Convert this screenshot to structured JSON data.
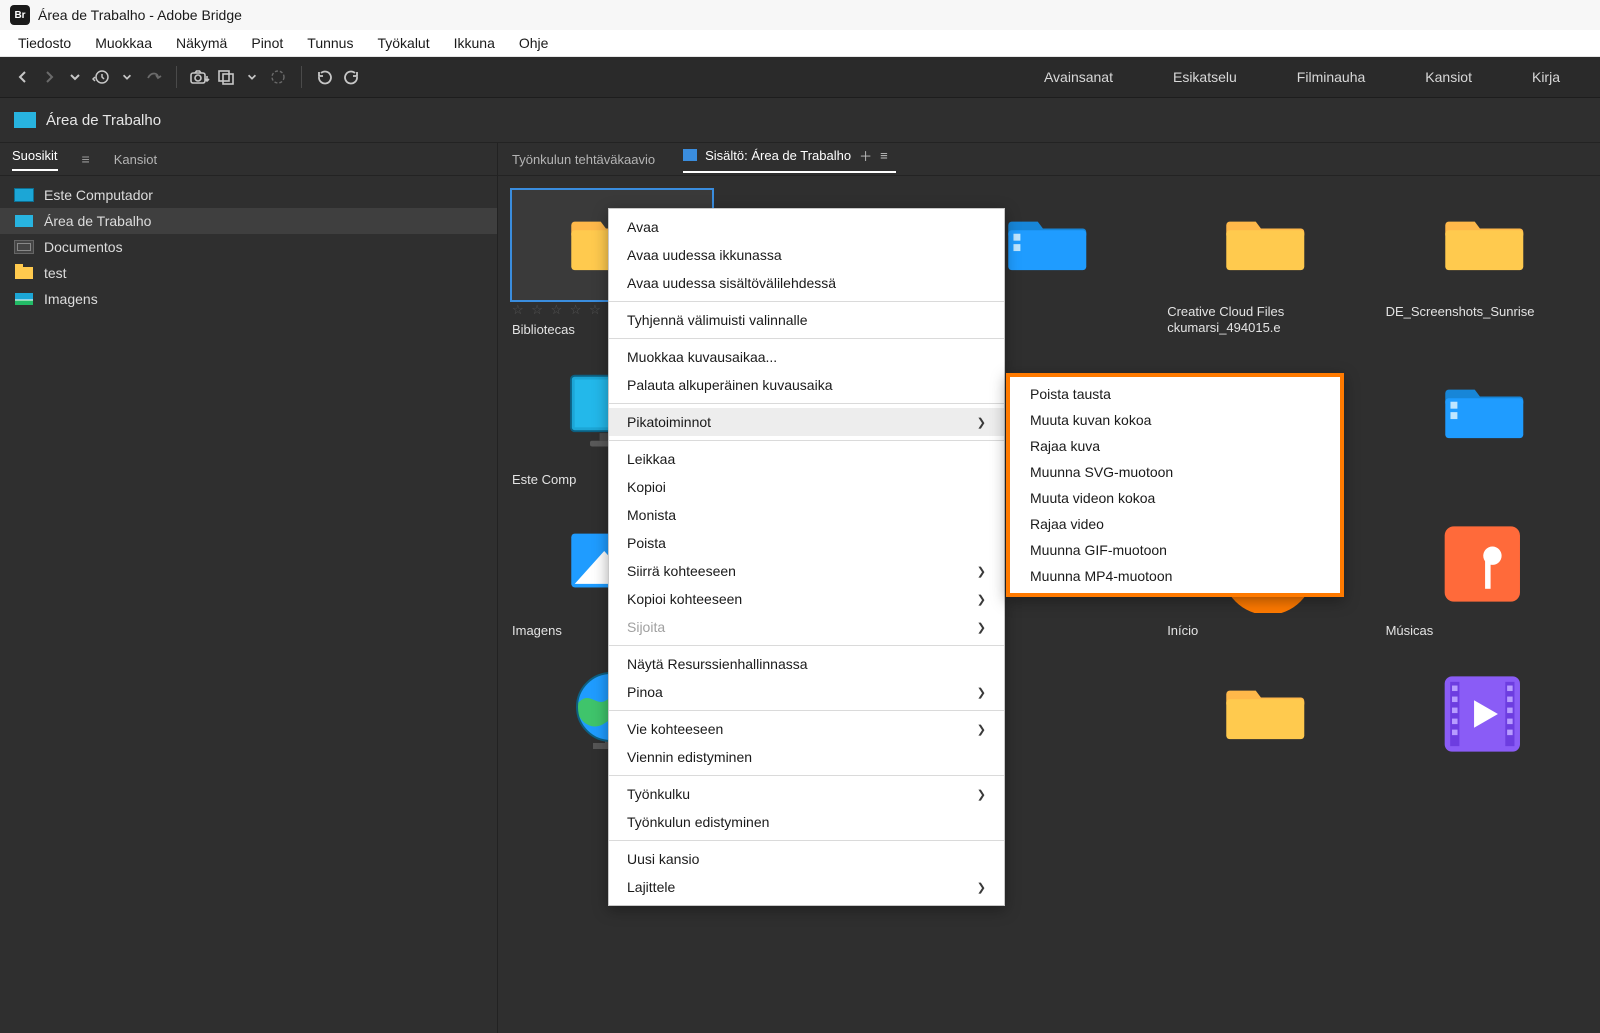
{
  "app_badge": "Br",
  "window_title": "Área de Trabalho - Adobe Bridge",
  "menubar": [
    "Tiedosto",
    "Muokkaa",
    "Näkymä",
    "Pinot",
    "Tunnus",
    "Työkalut",
    "Ikkuna",
    "Ohje"
  ],
  "workspaces": [
    "Avainsanat",
    "Esikatselu",
    "Filminauha",
    "Kansiot",
    "Kirja"
  ],
  "path": "Área de Trabalho",
  "left": {
    "tabs": {
      "suosikit": "Suosikit",
      "kansiot": "Kansiot"
    },
    "items": [
      {
        "label": "Este Computador",
        "icon": "monitor"
      },
      {
        "label": "Área de Trabalho",
        "icon": "blue",
        "selected": true
      },
      {
        "label": "Documentos",
        "icon": "docs"
      },
      {
        "label": "test",
        "icon": "folder"
      },
      {
        "label": "Imagens",
        "icon": "pic"
      }
    ]
  },
  "right": {
    "tab_workflow": "Työnkulun tehtäväkaavio",
    "tab_content": "Sisältö: Área de Trabalho"
  },
  "grid": [
    {
      "label": "Bibliotecas",
      "type": "folder",
      "selected": true,
      "stars": true
    },
    {
      "label": "",
      "type": "folder"
    },
    {
      "label": "",
      "type": "folder-blue"
    },
    {
      "label": "Creative Cloud Files ckumarsi_494015.e",
      "type": "folder"
    },
    {
      "label": "DE_Screenshots_Sunrise",
      "type": "folder"
    },
    {
      "label": "Este Comp",
      "type": "monitor"
    },
    {
      "label": "",
      "type": "hidden"
    },
    {
      "label": "",
      "type": "hidden"
    },
    {
      "label": "",
      "type": "folder-blue"
    },
    {
      "label": "",
      "type": "folder-blue"
    },
    {
      "label": "Imagens",
      "type": "image"
    },
    {
      "label": "",
      "type": "hidden"
    },
    {
      "label": "",
      "type": "hidden"
    },
    {
      "label": "Início",
      "type": "house"
    },
    {
      "label": "Músicas",
      "type": "note"
    },
    {
      "label": "",
      "type": "globe"
    },
    {
      "label": "",
      "type": "hidden"
    },
    {
      "label": "",
      "type": "hidden"
    },
    {
      "label": "",
      "type": "folder"
    },
    {
      "label": "",
      "type": "clip"
    }
  ],
  "context_menu": {
    "items": [
      {
        "label": "Avaa"
      },
      {
        "label": "Avaa uudessa ikkunassa"
      },
      {
        "label": "Avaa uudessa sisältövälilehdessä"
      },
      {
        "sep": true
      },
      {
        "label": "Tyhjennä välimuisti valinnalle"
      },
      {
        "sep": true
      },
      {
        "label": "Muokkaa kuvausaikaa..."
      },
      {
        "label": "Palauta alkuperäinen kuvausaika"
      },
      {
        "sep": true
      },
      {
        "label": "Pikatoiminnot",
        "arrow": true,
        "hl": true
      },
      {
        "sep": true
      },
      {
        "label": "Leikkaa"
      },
      {
        "label": "Kopioi"
      },
      {
        "label": "Monista"
      },
      {
        "label": "Poista"
      },
      {
        "label": "Siirrä kohteeseen",
        "arrow": true
      },
      {
        "label": "Kopioi kohteeseen",
        "arrow": true
      },
      {
        "label": "Sijoita",
        "arrow": true,
        "disabled": true
      },
      {
        "sep": true
      },
      {
        "label": "Näytä Resurssienhallinnassa"
      },
      {
        "label": "Pinoa",
        "arrow": true
      },
      {
        "sep": true
      },
      {
        "label": "Vie kohteeseen",
        "arrow": true
      },
      {
        "label": "Viennin edistyminen"
      },
      {
        "sep": true
      },
      {
        "label": "Työnkulku",
        "arrow": true
      },
      {
        "label": "Työnkulun edistyminen"
      },
      {
        "sep": true
      },
      {
        "label": "Uusi kansio"
      },
      {
        "label": "Lajittele",
        "arrow": true
      }
    ],
    "sub": [
      "Poista tausta",
      "Muuta kuvan kokoa",
      "Rajaa kuva",
      "Muunna SVG-muotoon",
      "Muuta videon kokoa",
      "Rajaa video",
      "Muunna GIF-muotoon",
      "Muunna MP4-muotoon"
    ]
  }
}
